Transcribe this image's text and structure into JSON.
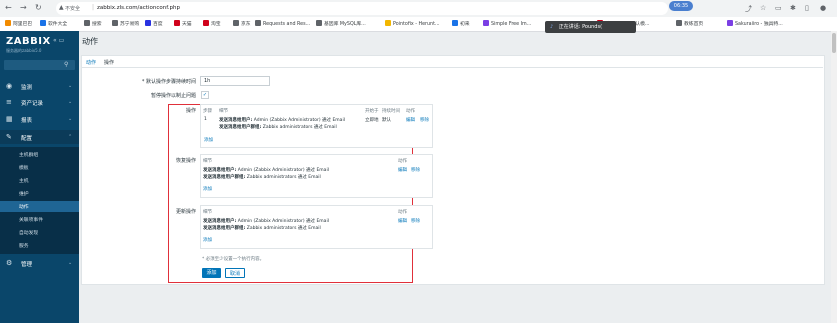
{
  "browser": {
    "url_warning": "不安全",
    "url": "zabbix.zls.com/actionconf.php",
    "time_badge": "06:35",
    "bookmarks": [
      {
        "label": "阿里巴巴",
        "color": "#f28b00"
      },
      {
        "label": "软件大全",
        "color": "#1a73e8"
      },
      {
        "label": "搜索",
        "color": "#5f6368"
      },
      {
        "label": "苏宁易购",
        "color": "#5f6368"
      },
      {
        "label": "百度",
        "color": "#2932e1"
      },
      {
        "label": "天猫",
        "color": "#d0021b"
      },
      {
        "label": "淘宝",
        "color": "#d0021b"
      },
      {
        "label": "京东",
        "color": "#5f6368"
      },
      {
        "label": "Requests and Res...",
        "color": "#5f6368"
      },
      {
        "label": "基因库 MySQL库...",
        "color": "#5f6368"
      },
      {
        "label": "Pointofix - Herunt...",
        "color": "#f2b600"
      },
      {
        "label": "初来",
        "color": "#1a73e8"
      },
      {
        "label": "Simple Free Im...",
        "color": "#7b3fe4"
      },
      {
        "label": "编写Typora默认模...",
        "color": "#d0021b"
      },
      {
        "label": "教练首页",
        "color": "#5f6368"
      },
      {
        "label": "Sakuraiiro - 独具特...",
        "color": "#7b3fe4"
      }
    ],
    "voice_popup": "正在讲话: Pounds("
  },
  "sidebar": {
    "logo": "ZABBIX",
    "server_name": "服务器的zabbix5.0",
    "menu": [
      {
        "label": "监测",
        "icon": "eye-icon"
      },
      {
        "label": "资产记录",
        "icon": "list-icon"
      },
      {
        "label": "报表",
        "icon": "chart-icon"
      },
      {
        "label": "配置",
        "icon": "wrench-icon"
      },
      {
        "label": "管理",
        "icon": "gear-icon"
      }
    ],
    "config_items": [
      "主机群组",
      "模板",
      "主机",
      "维护",
      "动作",
      "关联项事件",
      "自动发现",
      "服务"
    ]
  },
  "main": {
    "title": "动作",
    "tabs": [
      "动作",
      "操作"
    ],
    "duration_label": "* 默认操作步骤持续时间",
    "duration_value": "1h",
    "pause_label": "暂停操作以制止问题",
    "pause_check": "✓",
    "operations": {
      "label": "操作",
      "headers": [
        "步骤",
        "细节",
        "开始于",
        "持续时间",
        "动作"
      ],
      "row": {
        "step": "1",
        "detail_line1_bold": "发送消息给用户:",
        "detail_line1": " Admin (Zabbix Administrator) 通过 Email",
        "detail_line2_bold": "发送消息给用户群组:",
        "detail_line2": " Zabbix administrators 通过 Email",
        "start": "立即地",
        "duration": "默认",
        "edit": "编辑",
        "remove": "移除"
      },
      "add": "添加"
    },
    "recovery": {
      "label": "恢复操作",
      "headers": [
        "细节",
        "动作"
      ],
      "detail_line1_bold": "发送消息给用户:",
      "detail_line1": " Admin (Zabbix Administrator) 通过 Email",
      "detail_line2_bold": "发送消息给用户群组:",
      "detail_line2": " Zabbix administrators 通过 Email",
      "edit": "编辑",
      "remove": "移除",
      "add": "添加"
    },
    "update": {
      "label": "更新操作",
      "headers": [
        "细节",
        "动作"
      ],
      "detail_line1_bold": "发送消息给用户:",
      "detail_line1": " Admin (Zabbix Administrator) 通过 Email",
      "detail_line2_bold": "发送消息给用户群组:",
      "detail_line2": " Zabbix administrators 通过 Email",
      "edit": "编辑",
      "remove": "移除",
      "add": "添加"
    },
    "note": "* 必须至少设置一个执行内容。",
    "add_button": "添加",
    "cancel_button": "取消"
  }
}
